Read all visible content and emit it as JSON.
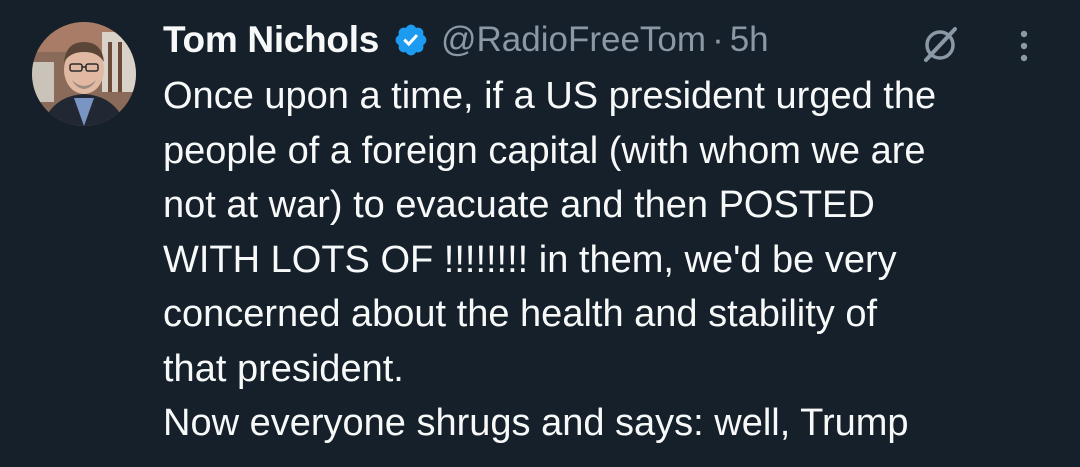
{
  "tweet": {
    "author": {
      "display_name": "Tom Nichols",
      "handle": "@RadioFreeTom",
      "separator": "·",
      "time": "5h",
      "verified_icon": "verified-badge-icon",
      "verified_color": "#1d9bf0"
    },
    "actions": {
      "grok_icon": "grok-icon",
      "more_icon": "more-options-icon"
    },
    "text_lines": [
      "Once upon a time, if a US president urged the",
      "people of a foreign capital (with whom we are",
      "not at war) to evacuate and then POSTED",
      "WITH LOTS OF !!!!!!!! in them, we'd be very",
      "concerned about the health and stability of",
      "that president.",
      "Now everyone shrugs and says: well, Trump"
    ]
  },
  "theme": {
    "background": "#15202b",
    "text": "#f7f9f9",
    "secondary_text": "#8b98a5"
  }
}
